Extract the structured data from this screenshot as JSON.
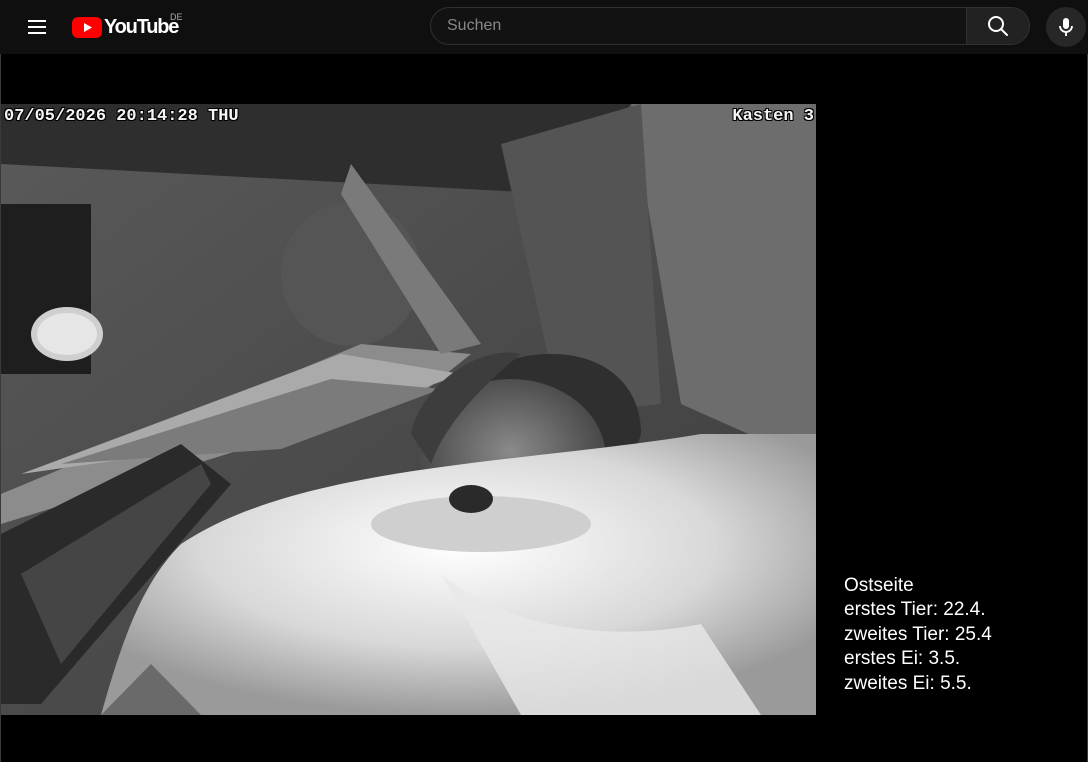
{
  "header": {
    "logo_text": "YouTube",
    "country_code": "DE",
    "search": {
      "placeholder": "Suchen",
      "value": ""
    },
    "icons": {
      "menu": "hamburger-menu-icon",
      "logo": "youtube-play-icon",
      "search": "search-icon",
      "mic": "microphone-icon"
    },
    "colors": {
      "background": "#0f0f0f",
      "logo_red": "#ff0000"
    }
  },
  "video": {
    "osd_timestamp": "07/05/2026 20:14:28 THU",
    "osd_camera": "Kasten 3",
    "info": {
      "title": "Ostseite",
      "lines": [
        "erstes Tier: 22.4.",
        "zweites Tier: 25.4",
        "erstes Ei: 3.5.",
        "zweites Ei: 5.5."
      ]
    }
  }
}
